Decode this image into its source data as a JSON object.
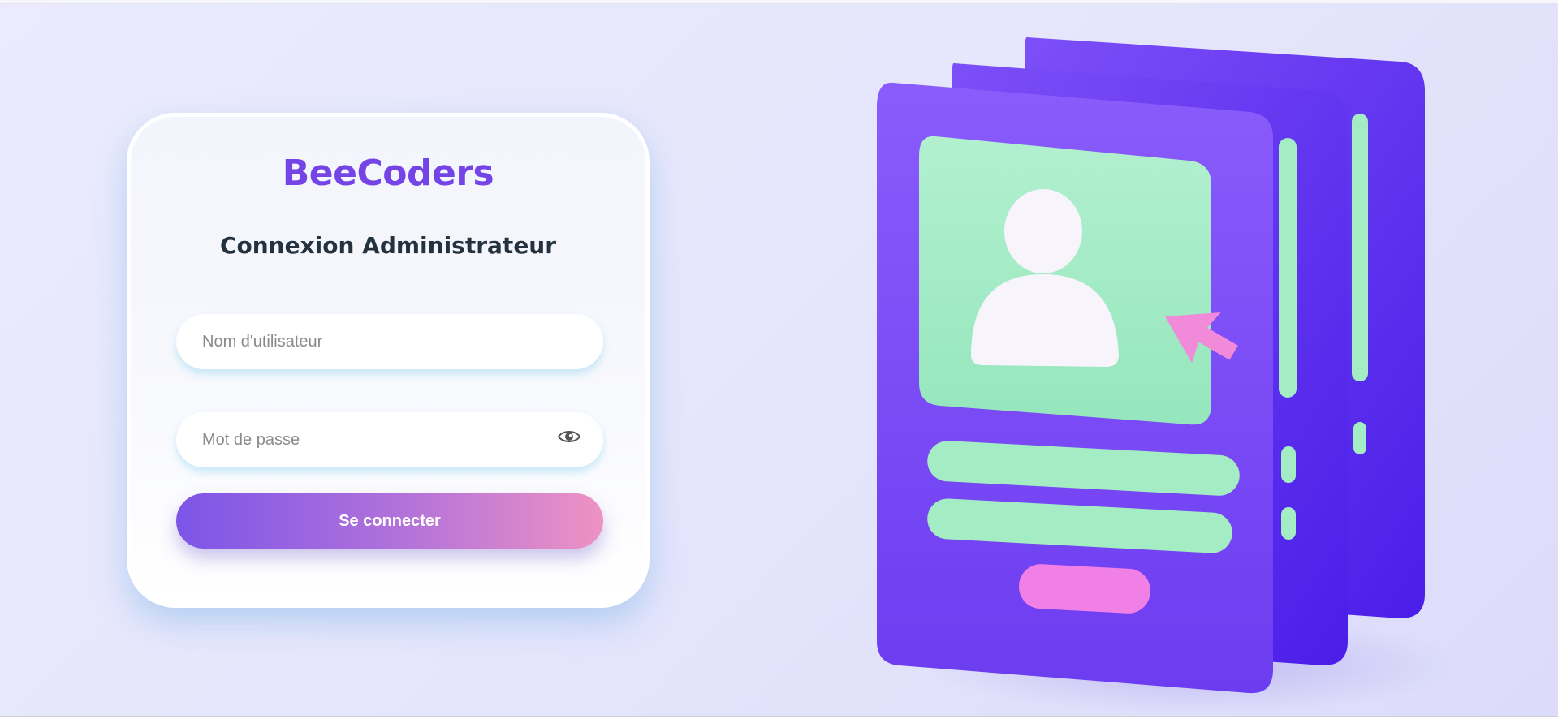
{
  "brand": {
    "name": "BeeCoders"
  },
  "login": {
    "title": "Connexion Administrateur",
    "username_placeholder": "Nom d'utilisateur",
    "username_value": "",
    "password_placeholder": "Mot de passe",
    "password_value": "",
    "submit_label": "Se connecter"
  },
  "icons": {
    "password_toggle": "eye-icon",
    "illustration": "profile-cards-illustration"
  },
  "colors": {
    "brand": "#7444e6",
    "button_gradient_start": "#7c55e8",
    "button_gradient_end": "#ee92c3",
    "card_purple": "#7b4ff5",
    "card_green": "#a3ecc4",
    "card_pink": "#f27fe8"
  }
}
